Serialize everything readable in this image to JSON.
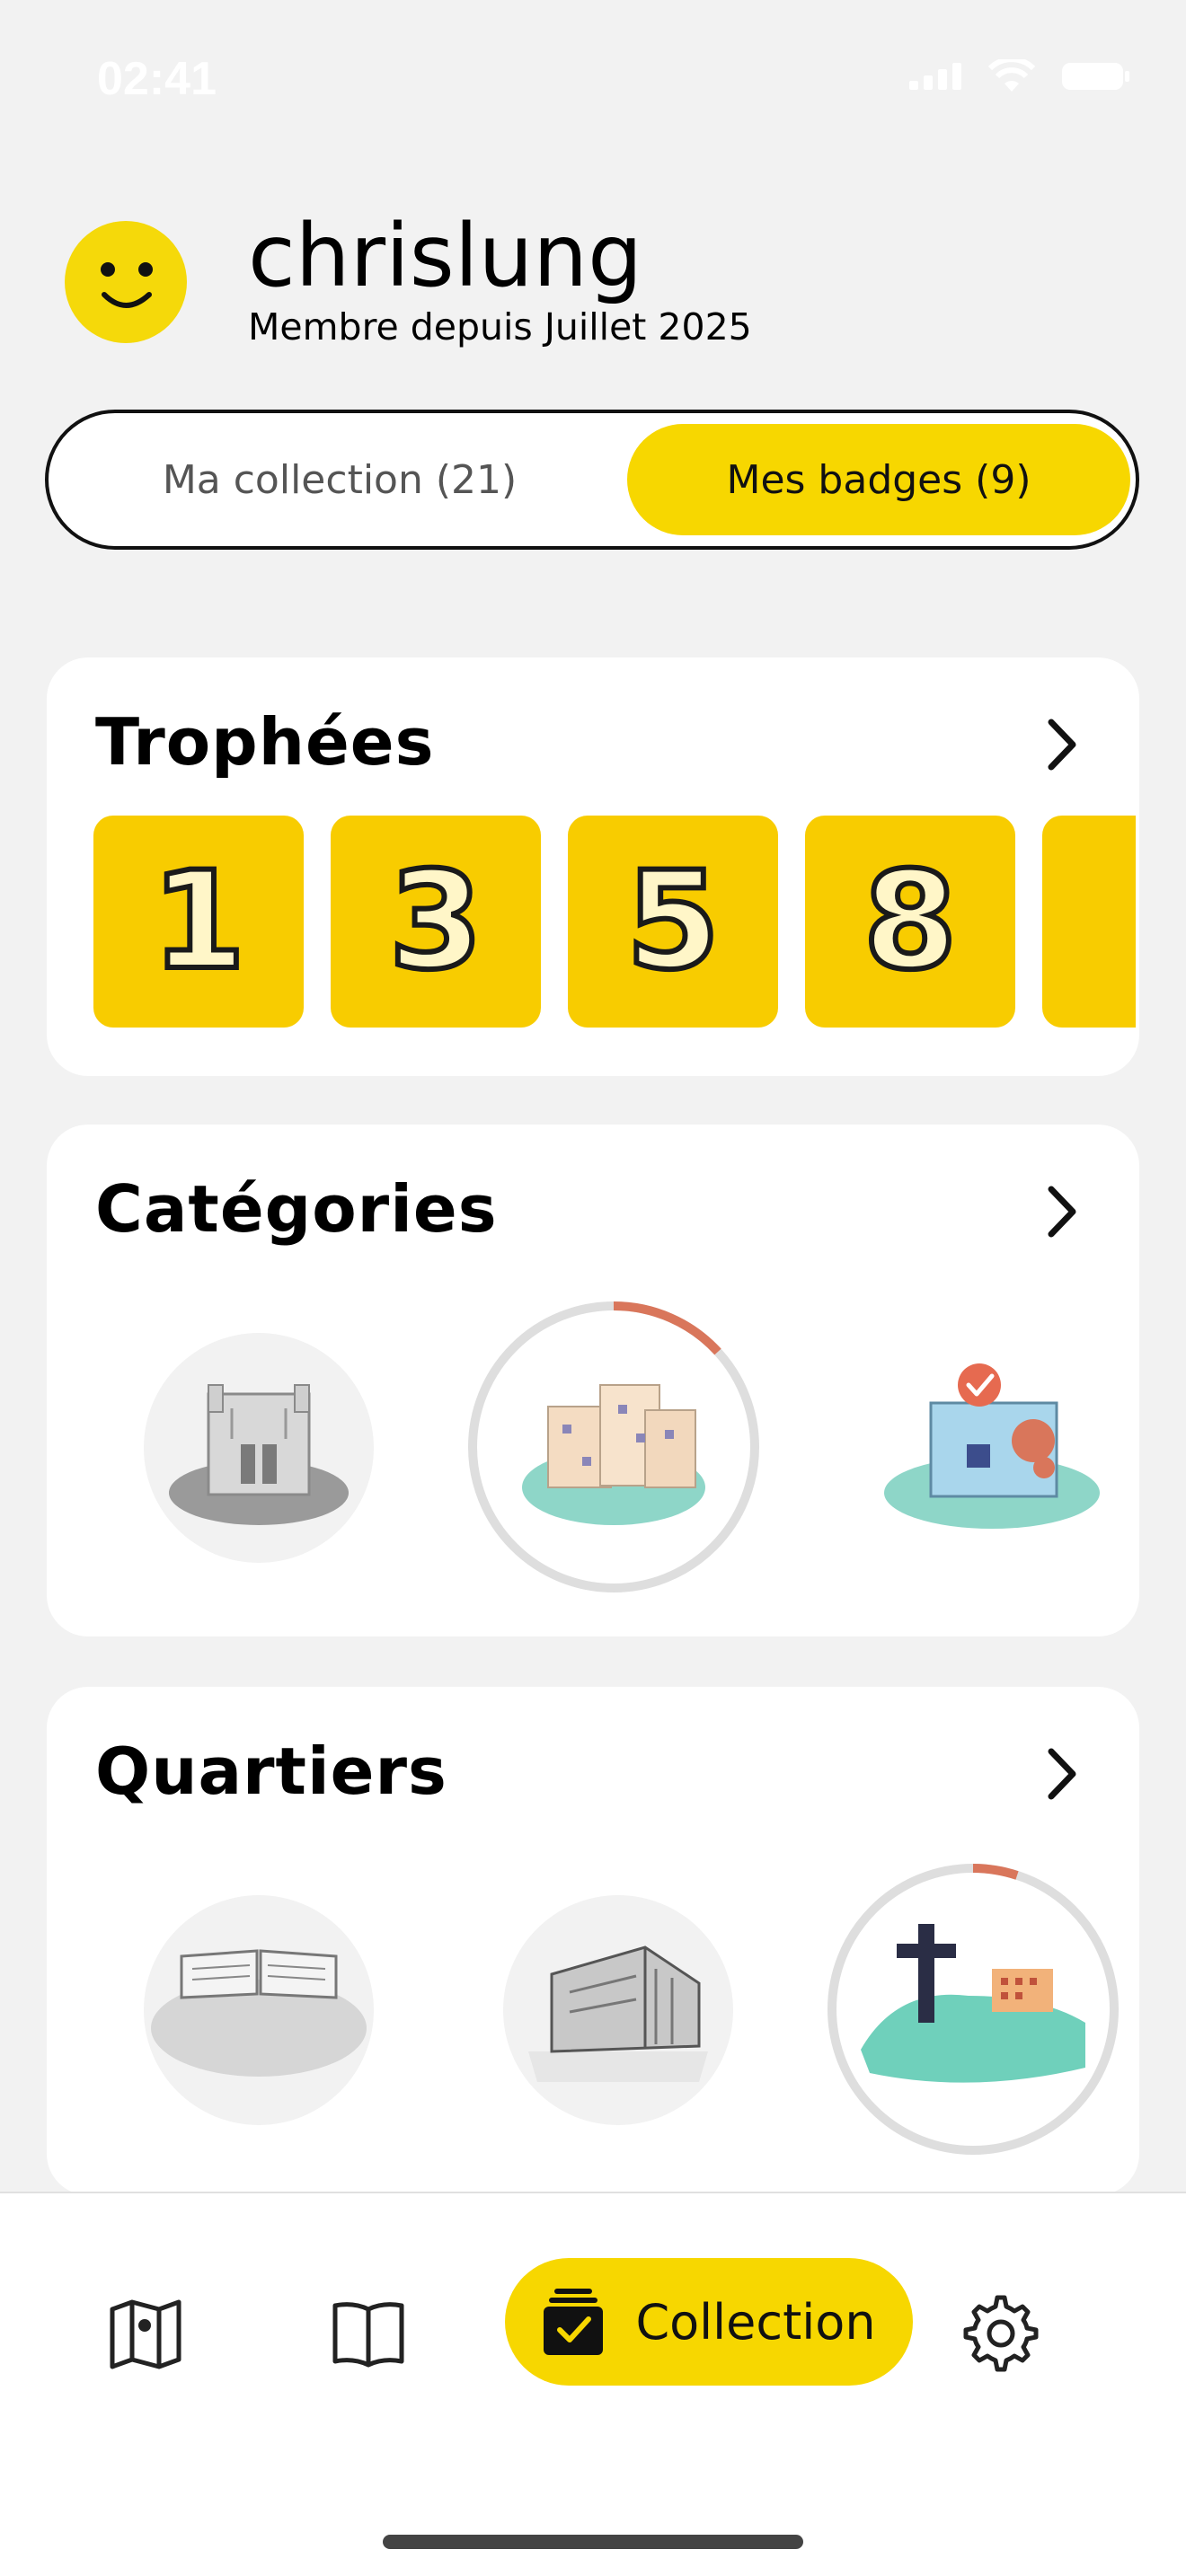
{
  "status_bar": {
    "time": "02:41"
  },
  "profile": {
    "username": "chrislung",
    "member_since": "Membre depuis Juillet 2025",
    "avatar_color": "#f5d90a"
  },
  "toggle": {
    "collection_label": "Ma collection (21)",
    "badges_label": "Mes badges (9)",
    "active": "badges"
  },
  "trophies": {
    "title": "Trophées",
    "items": [
      "1",
      "3",
      "5",
      "8"
    ]
  },
  "categories": {
    "title": "Catégories",
    "items": [
      {
        "icon": "gothic-building-icon",
        "unlocked": false,
        "progress": 0
      },
      {
        "icon": "apartment-blocks-icon",
        "unlocked": true,
        "progress": 0.12
      },
      {
        "icon": "bakery-shop-icon",
        "unlocked": true,
        "progress": 1
      }
    ]
  },
  "quartiers": {
    "title": "Quartiers",
    "items": [
      {
        "icon": "open-book-building-icon",
        "unlocked": false,
        "progress": 0
      },
      {
        "icon": "modern-building-icon",
        "unlocked": false,
        "progress": 0
      },
      {
        "icon": "cross-hill-icon",
        "unlocked": true,
        "progress": 0.05
      }
    ]
  },
  "bottom_nav": {
    "active_label": "Collection",
    "accent": "#f7d700"
  }
}
